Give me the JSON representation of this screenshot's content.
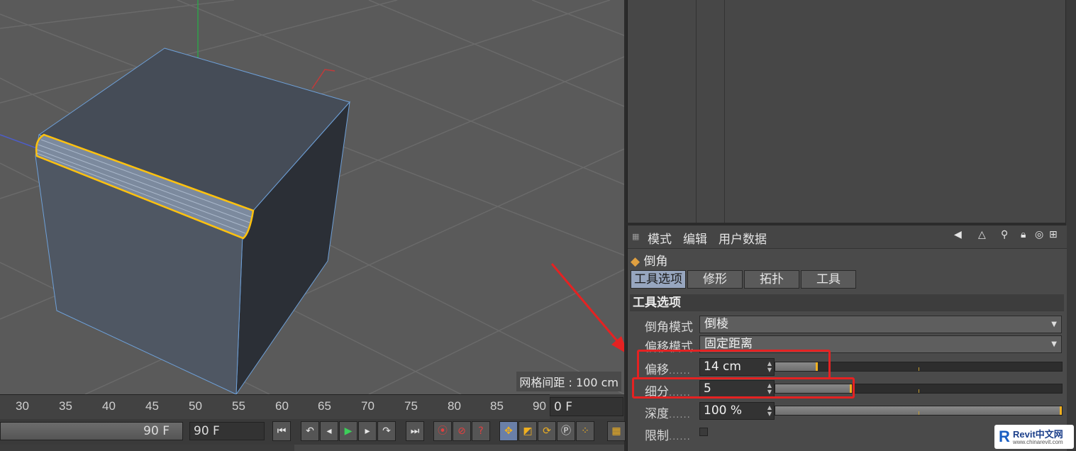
{
  "viewport": {
    "grid_spacing": "网格间距 : 100 cm"
  },
  "timeline": {
    "ticks": [
      "30",
      "35",
      "40",
      "45",
      "50",
      "55",
      "60",
      "65",
      "70",
      "75",
      "80",
      "85",
      "90"
    ],
    "current_frame": "0 F",
    "range_end": "90 F",
    "preview_end": "90 F"
  },
  "attr": {
    "menu": [
      "模式",
      "编辑",
      "用户数据"
    ],
    "title": "倒角",
    "tabs": [
      "工具选项",
      "修形",
      "拓扑",
      "工具"
    ],
    "section": "工具选项",
    "rows": {
      "bevel_mode": {
        "label": "倒角模式",
        "value": "倒棱"
      },
      "offset_mode": {
        "label": "偏移模式",
        "value": "固定距离"
      },
      "offset": {
        "label": "偏移",
        "value": "14 cm",
        "fraction": 0.14
      },
      "subdiv": {
        "label": "细分",
        "value": "5",
        "fraction": 0.26
      },
      "depth": {
        "label": "深度",
        "value": "100 %",
        "fraction": 1.0
      },
      "limit": {
        "label": "限制"
      }
    },
    "dots": "......"
  },
  "watermark": {
    "brand": "Revit中文网",
    "url": "www.chinarevit.com"
  },
  "colors": {
    "accent": "#f0b020",
    "highlight": "#e52222",
    "selection": "#ffc20e"
  }
}
